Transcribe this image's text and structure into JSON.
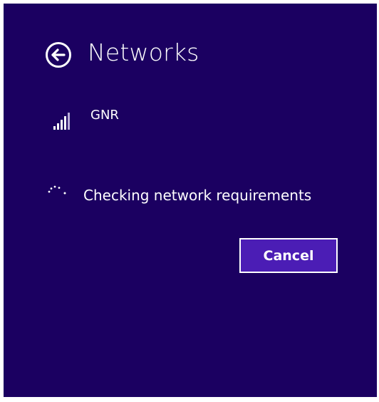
{
  "panel": {
    "title": "Networks",
    "back_icon": "back-arrow-circle-icon"
  },
  "network": {
    "name": "GNR",
    "icon": "wifi-signal-icon",
    "signal_bars": 5,
    "signal_strength_filled": 4
  },
  "status": {
    "icon": "loading-spinner-icon",
    "text": "Checking network requirements"
  },
  "actions": {
    "cancel_label": "Cancel"
  },
  "colors": {
    "background": "#1b0061",
    "button": "#4b1db5",
    "text": "#ffffff",
    "signal_inactive": "#b9acd8"
  }
}
